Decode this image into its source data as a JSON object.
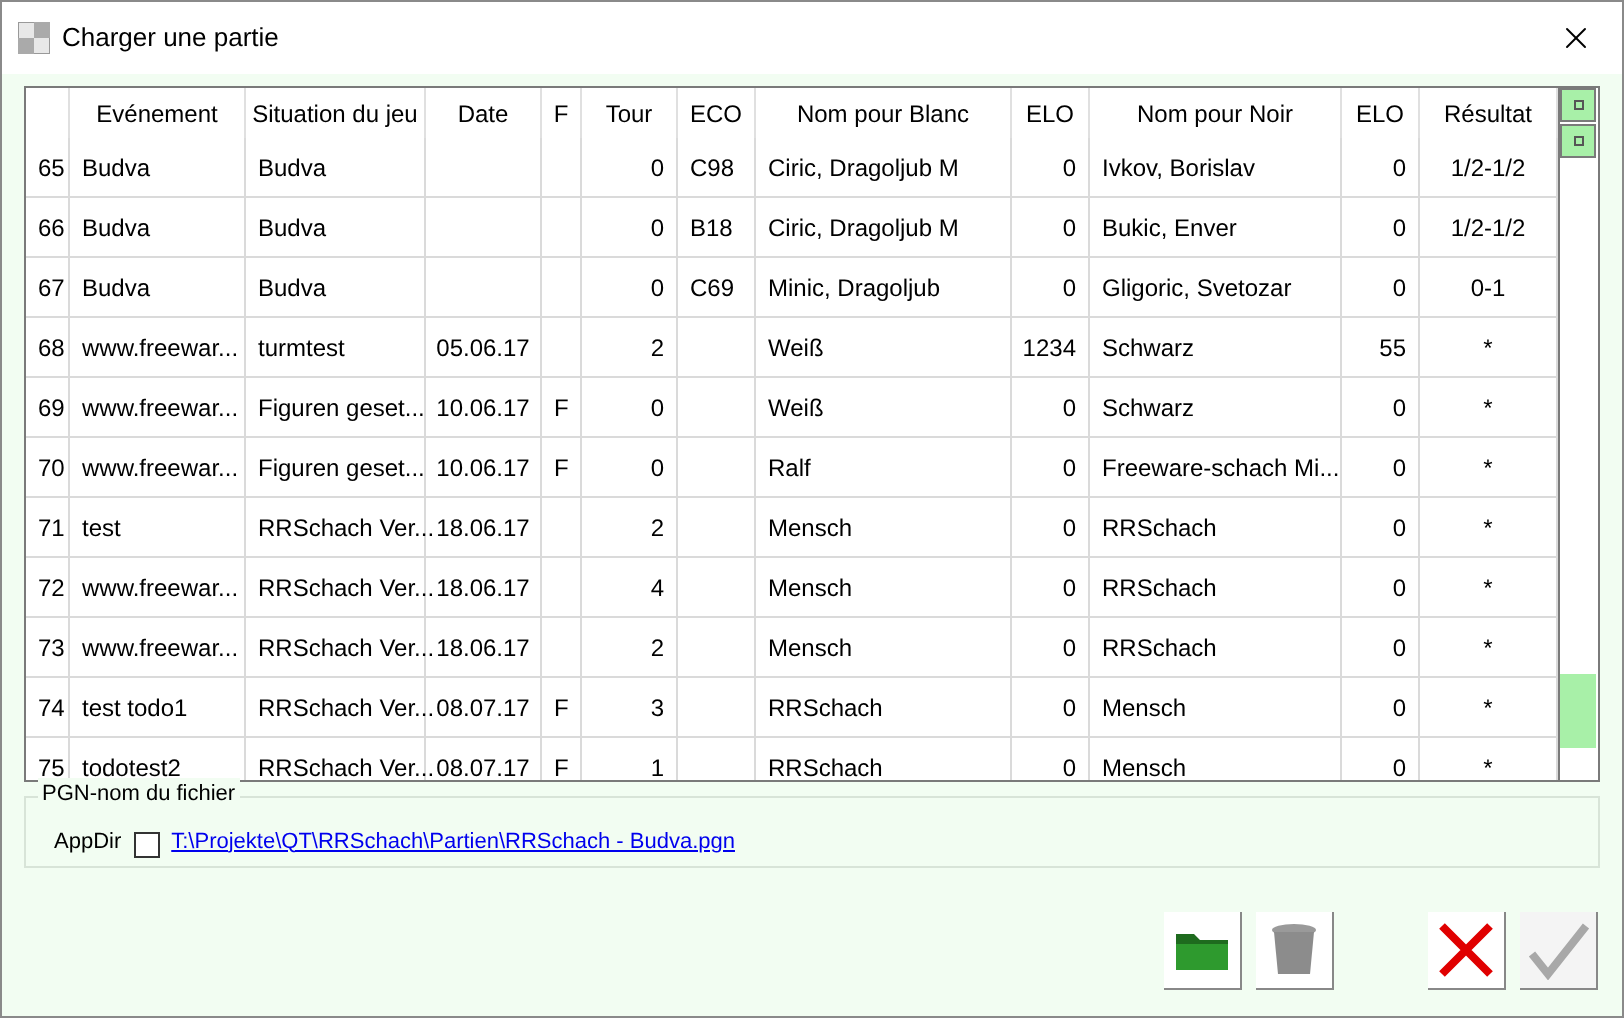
{
  "window": {
    "title": "Charger une partie"
  },
  "table": {
    "columns": [
      "",
      "Evénement",
      "Situation du jeu",
      "Date",
      "F",
      "Tour",
      "ECO",
      "Nom pour Blanc",
      "ELO",
      "Nom pour Noir",
      "ELO",
      "Résultat"
    ],
    "rows": [
      [
        "65",
        "Budva",
        "Budva",
        null,
        null,
        "0",
        "C98",
        "Ciric, Dragoljub M",
        "0",
        "Ivkov, Borislav",
        "0",
        "1/2-1/2"
      ],
      [
        "66",
        "Budva",
        "Budva",
        null,
        null,
        "0",
        "B18",
        "Ciric, Dragoljub M",
        "0",
        "Bukic, Enver",
        "0",
        "1/2-1/2"
      ],
      [
        "67",
        "Budva",
        "Budva",
        null,
        null,
        "0",
        "C69",
        "Minic, Dragoljub",
        "0",
        "Gligoric, Svetozar",
        "0",
        "0-1"
      ],
      [
        "68",
        "www.freewar...",
        "turmtest",
        "05.06.17",
        null,
        "2",
        null,
        "Weiß",
        "1234",
        "Schwarz",
        "55",
        "*"
      ],
      [
        "69",
        "www.freewar...",
        "Figuren geset...",
        "10.06.17",
        "F",
        "0",
        null,
        "Weiß",
        "0",
        "Schwarz",
        "0",
        "*"
      ],
      [
        "70",
        "www.freewar...",
        "Figuren geset...",
        "10.06.17",
        "F",
        "0",
        null,
        "Ralf",
        "0",
        "Freeware-schach Mi...",
        "0",
        "*"
      ],
      [
        "71",
        "test",
        "RRSchach Ver...",
        "18.06.17",
        null,
        "2",
        null,
        "Mensch",
        "0",
        "RRSchach",
        "0",
        "*"
      ],
      [
        "72",
        "www.freewar...",
        "RRSchach Ver...",
        "18.06.17",
        null,
        "4",
        null,
        "Mensch",
        "0",
        "RRSchach",
        "0",
        "*"
      ],
      [
        "73",
        "www.freewar...",
        "RRSchach Ver...",
        "18.06.17",
        null,
        "2",
        null,
        "Mensch",
        "0",
        "RRSchach",
        "0",
        "*"
      ],
      [
        "74",
        "test todo1",
        "RRSchach Ver...",
        "08.07.17",
        "F",
        "3",
        null,
        "RRSchach",
        "0",
        "Mensch",
        "0",
        "*"
      ],
      [
        "75",
        "todotest2",
        "RRSchach Ver...",
        "08.07.17",
        "F",
        "1",
        null,
        "RRSchach",
        "0",
        "Mensch",
        "0",
        "*"
      ]
    ]
  },
  "file_group": {
    "title": "PGN-nom du fichier",
    "appdir_label": "AppDir",
    "appdir_checked": false,
    "path": "T:\\Projekte\\QT\\RRSchach\\Partien\\RRSchach - Budva.pgn"
  },
  "buttons": [
    {
      "kind": "open",
      "disabled": false
    },
    {
      "kind": "delete",
      "disabled": false
    },
    {
      "kind": "cancel",
      "disabled": false
    },
    {
      "kind": "ok",
      "disabled": true
    }
  ]
}
